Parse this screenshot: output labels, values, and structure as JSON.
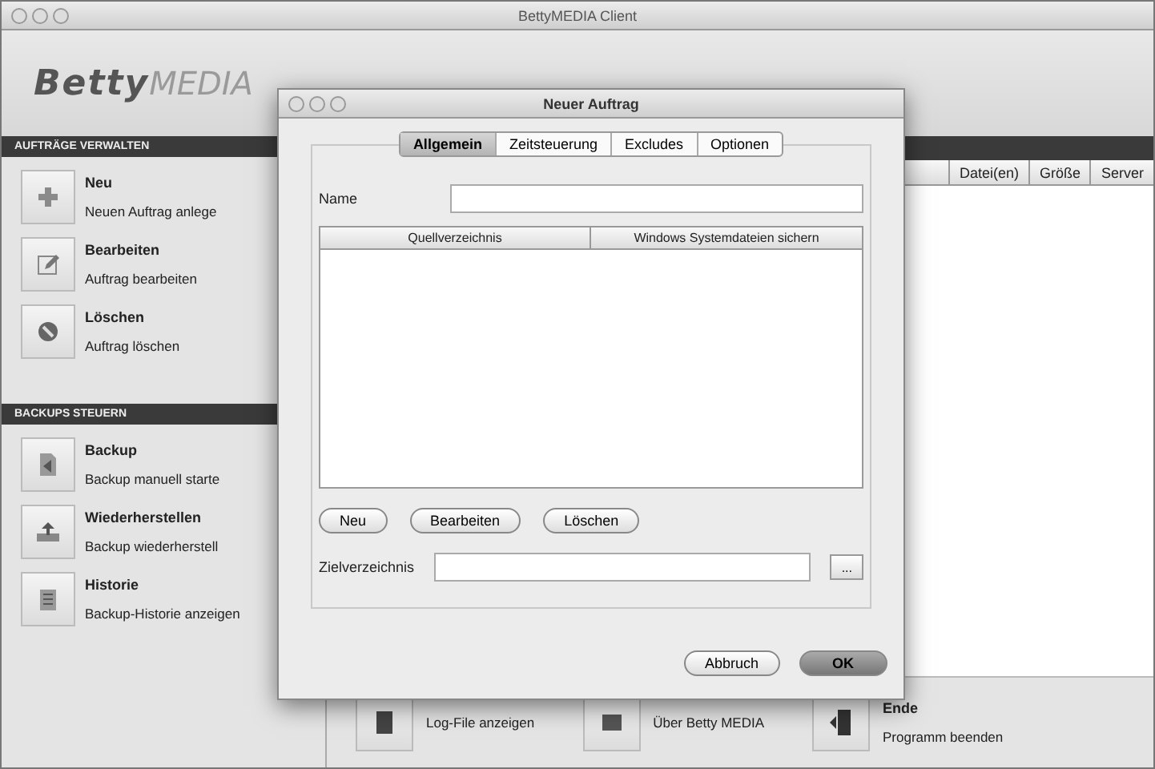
{
  "window": {
    "title": "BettyMEDIA Client"
  },
  "logo": {
    "part_1": "Betty",
    "part_2": "MEDIA"
  },
  "sidebar": {
    "sections": [
      {
        "title": "AUFTRÄGE VERWALTEN",
        "items": [
          {
            "kind": "plus",
            "title": "Neu",
            "subtitle": "Neuen Auftrag anlege"
          },
          {
            "kind": "edit",
            "title": "Bearbeiten",
            "subtitle": "Auftrag bearbeiten"
          },
          {
            "kind": "delete",
            "title": "Löschen",
            "subtitle": "Auftrag löschen"
          }
        ]
      },
      {
        "title": "BACKUPS STEUERN",
        "items": [
          {
            "kind": "backup",
            "title": "Backup",
            "subtitle": "Backup manuell starte"
          },
          {
            "kind": "restore",
            "title": "Wiederherstellen",
            "subtitle": "Backup wiederherstell"
          },
          {
            "kind": "history",
            "title": "Historie",
            "subtitle": "Backup-Historie anzeigen"
          }
        ]
      }
    ]
  },
  "table": {
    "columns": [
      "Datei(en)",
      "Größe",
      "Server"
    ]
  },
  "toolbar": [
    {
      "kind": "log",
      "label": "Log-File anzeigen"
    },
    {
      "kind": "about",
      "label": "Über Betty MEDIA"
    },
    {
      "kind": "quit",
      "title": "Ende",
      "label": "Programm beenden"
    }
  ],
  "dialog": {
    "title": "Neuer Auftrag",
    "tabs": [
      {
        "label": "Allgemein",
        "selected": true
      },
      {
        "label": "Zeitsteuerung",
        "selected": false
      },
      {
        "label": "Excludes",
        "selected": false
      },
      {
        "label": "Optionen",
        "selected": false
      }
    ],
    "name_label": "Name",
    "list_columns": [
      "Quellverzeichnis",
      "Windows Systemdateien sichern"
    ],
    "list_buttons": [
      "Neu",
      "Bearbeiten",
      "Löschen"
    ],
    "target_label": "Zielverzeichnis",
    "browse_button": "...",
    "buttons": [
      {
        "label": "Abbruch",
        "default": false
      },
      {
        "label": "OK",
        "default": true
      }
    ]
  }
}
